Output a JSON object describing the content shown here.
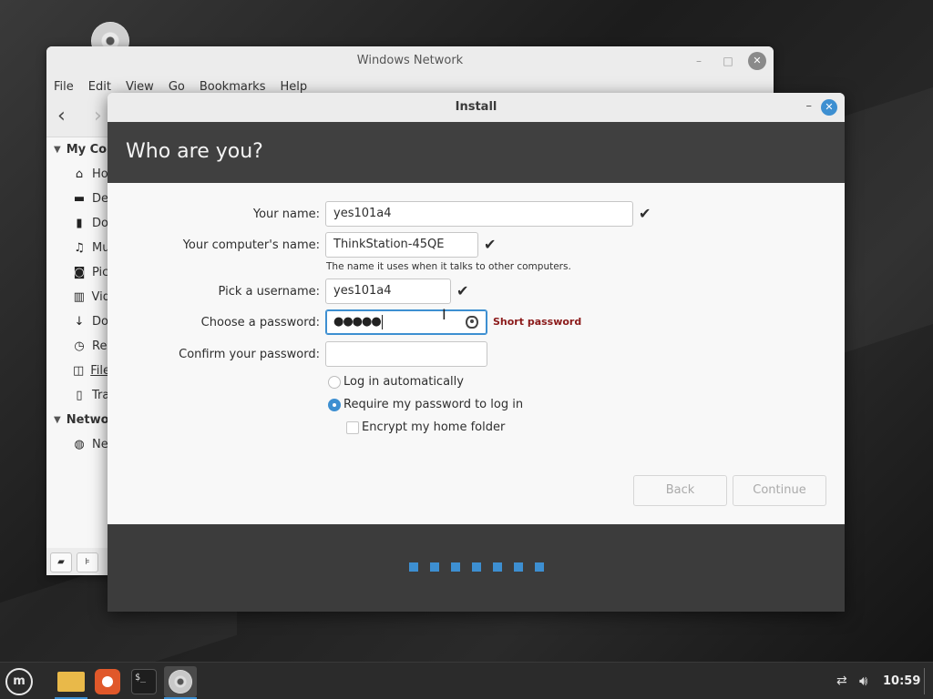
{
  "file_manager": {
    "title": "Windows Network",
    "menu": [
      "File",
      "Edit",
      "View",
      "Go",
      "Bookmarks",
      "Help"
    ],
    "sidebar": {
      "my_computer_header": "My Co",
      "items": [
        {
          "label": "Ho",
          "icon": "home-icon"
        },
        {
          "label": "De",
          "icon": "desktop-icon"
        },
        {
          "label": "Do",
          "icon": "document-icon"
        },
        {
          "label": "Mu",
          "icon": "music-icon"
        },
        {
          "label": "Pic",
          "icon": "camera-icon"
        },
        {
          "label": "Vid",
          "icon": "film-icon"
        },
        {
          "label": "Do",
          "icon": "download-icon"
        },
        {
          "label": "Re",
          "icon": "clock-icon"
        },
        {
          "label": "File",
          "icon": "drive-icon"
        },
        {
          "label": "Tra",
          "icon": "trash-icon"
        }
      ],
      "network_header": "Netwo",
      "network_items": [
        {
          "label": "Ne",
          "icon": "globe-icon"
        }
      ]
    }
  },
  "installer": {
    "title": "Install",
    "heading": "Who are you?",
    "form": {
      "name_label": "Your name:",
      "name_value": "yes101a4",
      "computer_label": "Your computer's name:",
      "computer_value": "ThinkStation-45QE",
      "computer_hint": "The name it uses when it talks to other computers.",
      "username_label": "Pick a username:",
      "username_value": "yes101a4",
      "password_label": "Choose a password:",
      "password_masked": "●●●●●",
      "password_warning": "Short password",
      "confirm_label": "Confirm your password:",
      "confirm_value": ""
    },
    "options": {
      "login_auto": "Log in automatically",
      "require_password": "Require my password to log in",
      "encrypt_home": "Encrypt my home folder",
      "selected": "require_password",
      "encrypt_checked": false
    },
    "buttons": {
      "back": "Back",
      "continue": "Continue"
    },
    "progress_steps": 7
  },
  "taskbar": {
    "apps": [
      "file-manager",
      "firefox",
      "terminal",
      "installer-cd"
    ],
    "terminal_glyph": "$_",
    "clock": "10:59"
  },
  "colors": {
    "accent": "#3d8fd1",
    "warning": "#8b1a1a",
    "header_bg": "#404040"
  }
}
